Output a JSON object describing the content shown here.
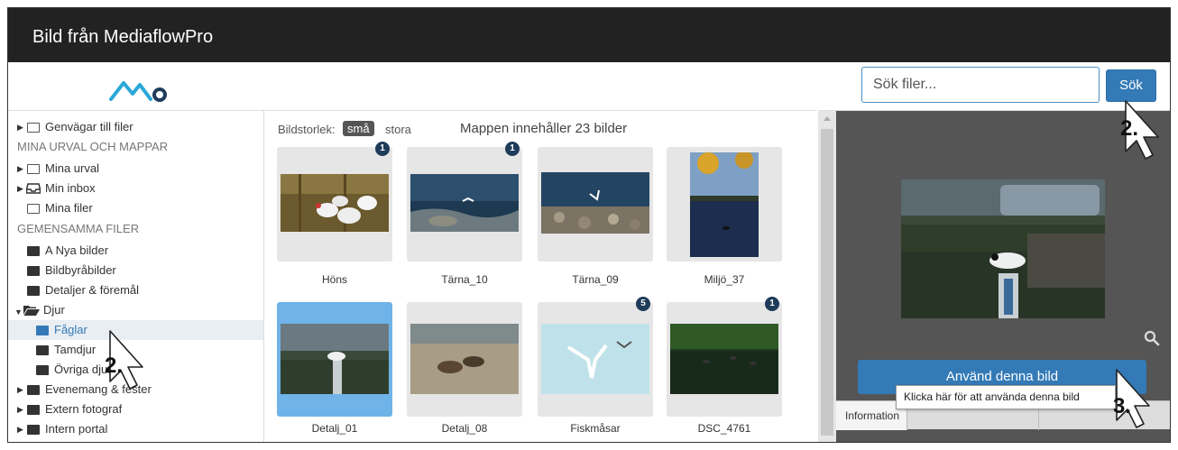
{
  "window": {
    "title": "Bild från MediaflowPro"
  },
  "search": {
    "placeholder": "Sök filer...",
    "button_label": "Sök"
  },
  "sidebar": {
    "shortcuts": "Genvägar till filer",
    "heading_mine": "MINA URVAL OCH MAPPAR",
    "mina_urval": "Mina urval",
    "min_inbox": "Min inbox",
    "mina_filer": "Mina filer",
    "heading_shared": "GEMENSAMMA FILER",
    "a_nya_bilder": "A Nya bilder",
    "bildbyrabilder": "Bildbyråbilder",
    "detaljer": "Detaljer & föremål",
    "djur": "Djur",
    "faglar": "Fåglar",
    "tamdjur": "Tamdjur",
    "ovriga_djur": "Övriga djur",
    "evenemang": "Evenemang & fester",
    "extern_fotograf": "Extern fotograf",
    "intern_portal": "Intern portal"
  },
  "gallery": {
    "size_label": "Bildstorlek:",
    "size_small": "små",
    "size_large": "stora",
    "folder_count": "Mappen innehåller 23 bilder",
    "tiles": [
      {
        "caption": "Höns",
        "badge": "1"
      },
      {
        "caption": "Tärna_10",
        "badge": "1"
      },
      {
        "caption": "Tärna_09",
        "badge": ""
      },
      {
        "caption": "Miljö_37",
        "badge": ""
      },
      {
        "caption": "Detalj_01",
        "badge": ""
      },
      {
        "caption": "Detalj_08",
        "badge": ""
      },
      {
        "caption": "Fiskmåsar",
        "badge": "5"
      },
      {
        "caption": "DSC_4761",
        "badge": "1"
      }
    ]
  },
  "preview": {
    "use_button": "Använd denna bild",
    "info_tab": "Information",
    "tooltip": "Klicka här för att använda denna bild"
  },
  "annotations": {
    "step1": "2.",
    "step2": "2.",
    "step3": "3."
  },
  "colors": {
    "accent": "#337ab7",
    "titlebar": "#222222",
    "badge": "#1f3b5a",
    "selected_tile": "#6fb3e8"
  }
}
